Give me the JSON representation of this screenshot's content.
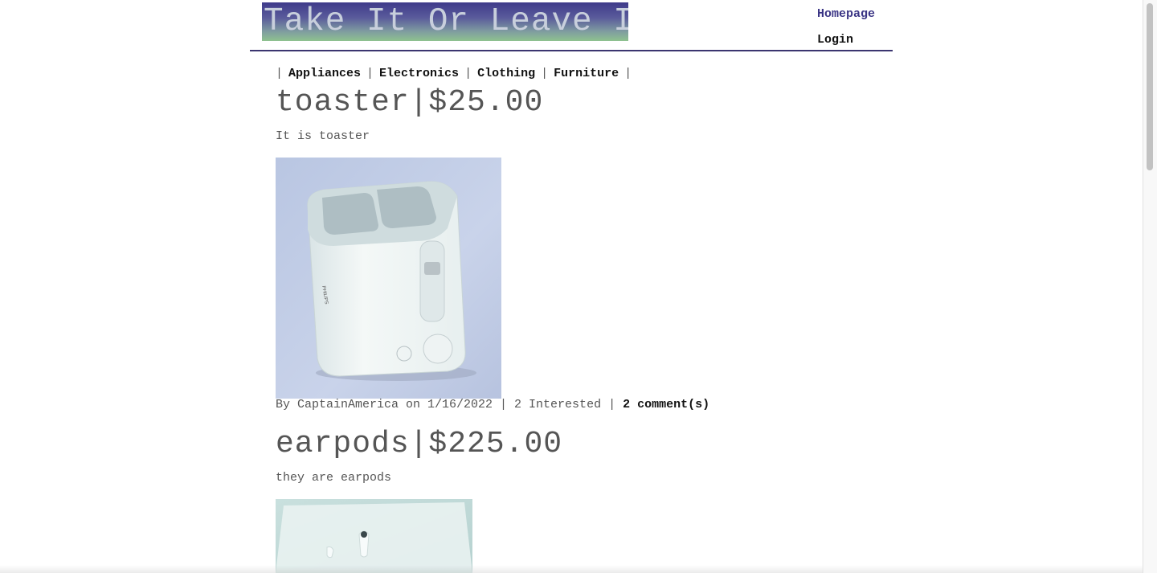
{
  "header": {
    "logo_text": "Take It Or Leave It",
    "nav": {
      "homepage": "Homepage",
      "login": "Login"
    }
  },
  "categories": {
    "separator": "|",
    "items": [
      "Appliances",
      "Electronics",
      "Clothing",
      "Furniture"
    ]
  },
  "posts": [
    {
      "title": "toaster|$25.00",
      "description": "It is toaster",
      "image_icon": "toaster-photo",
      "meta_prefix": "By CaptainAmerica on 1/16/2022 | 2 Interested | ",
      "comments_label": "2 comment(s)"
    },
    {
      "title": "earpods|$225.00",
      "description": "they are earpods",
      "image_icon": "earpods-photo"
    }
  ],
  "colors": {
    "accent": "#3b3585",
    "rule": "#3b3570",
    "text": "#555555"
  }
}
